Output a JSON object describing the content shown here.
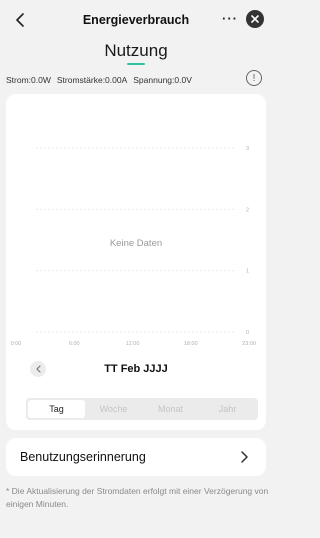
{
  "header": {
    "title": "Energieverbrauch",
    "more_label": "···"
  },
  "tab_title": "Nutzung",
  "metrics": {
    "power": "Strom:0.0W",
    "current": "Stromstärke:0.00A",
    "voltage": "Spannung:0.0V"
  },
  "info_label": "!",
  "chart_data": {
    "type": "line",
    "title": "",
    "xlabel": "",
    "ylabel": "",
    "x_ticks": [
      "0:00",
      "6:00",
      "12:00",
      "18:00",
      "23:00"
    ],
    "y_ticks": [
      "0",
      "1",
      "2",
      "3"
    ],
    "ylim": [
      0,
      3
    ],
    "grid": true,
    "series": [],
    "empty_message": "Keine Daten"
  },
  "date_label": "TT Feb JJJJ",
  "period_tabs": [
    "Tag",
    "Woche",
    "Monat",
    "Jahr"
  ],
  "active_period": "Tag",
  "reminder_label": "Benutzungserinnerung",
  "note": "* Die Aktualisierung der Stromdaten erfolgt mit einer Verzögerung von einigen Minuten.",
  "colors": {
    "accent": "#2ec39a",
    "background": "#f2f2f2",
    "card": "#ffffff",
    "muted_text": "#8a8a8a"
  },
  "icons": {
    "back": "chevron-left-icon",
    "close": "close-icon",
    "info": "info-icon",
    "prev_date": "chevron-left-icon",
    "reminder": "chevron-right-icon"
  }
}
